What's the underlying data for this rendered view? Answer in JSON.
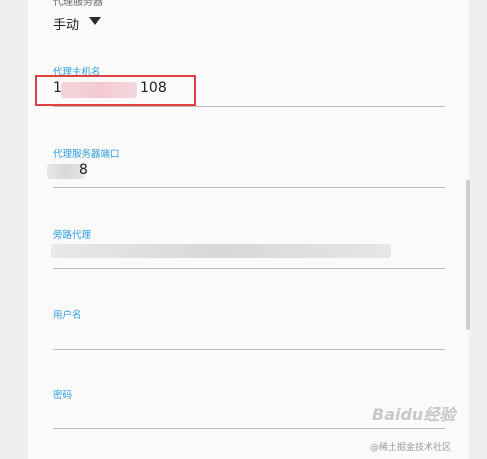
{
  "proxy": {
    "label": "代理服务器",
    "value": "手动"
  },
  "fields": {
    "host": {
      "label": "代理主机名",
      "value_start": "1",
      "value_end": "108"
    },
    "port": {
      "label": "代理服务器端口",
      "value_end": "8"
    },
    "bypass": {
      "label": "旁路代理"
    },
    "username": {
      "label": "用户名"
    },
    "password": {
      "label": "密码"
    }
  },
  "watermark": {
    "logo": "Baidu经验",
    "text": "@稀土掘金技术社区"
  },
  "colors": {
    "accent": "#2b9fe0",
    "highlight": "#e04040"
  }
}
